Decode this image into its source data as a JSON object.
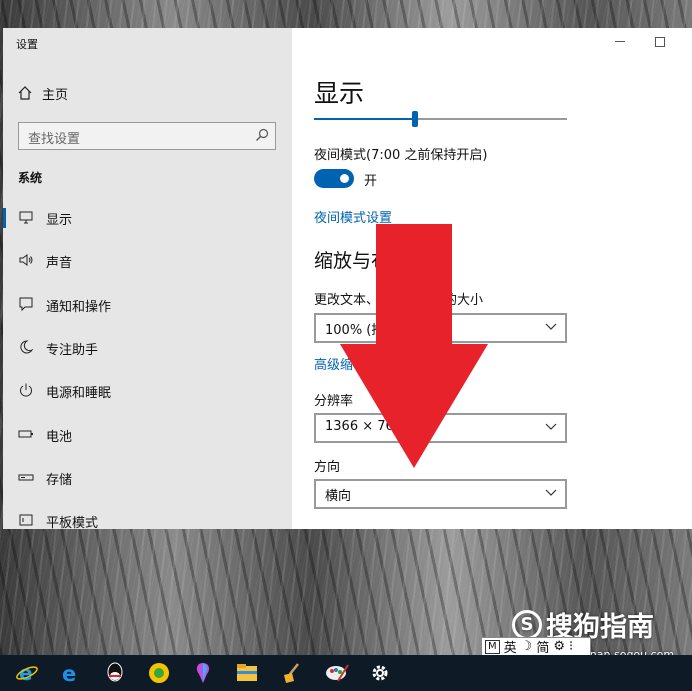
{
  "window": {
    "title": "设置"
  },
  "sidebar": {
    "home_label": "主页",
    "search_placeholder": "查找设置",
    "section": "系统",
    "items": [
      {
        "label": "显示",
        "icon": "monitor-icon",
        "selected": true
      },
      {
        "label": "声音",
        "icon": "speaker-icon"
      },
      {
        "label": "通知和操作",
        "icon": "notification-icon"
      },
      {
        "label": "专注助手",
        "icon": "moon-icon"
      },
      {
        "label": "电源和睡眠",
        "icon": "power-icon"
      },
      {
        "label": "电池",
        "icon": "battery-icon"
      },
      {
        "label": "存储",
        "icon": "storage-icon"
      },
      {
        "label": "平板模式",
        "icon": "tablet-icon"
      }
    ]
  },
  "main": {
    "title": "显示",
    "brightness_level": 0.4,
    "night_light_label": "夜间模式(7:00 之前保持开启)",
    "night_light_state": "开",
    "night_light_settings_link": "夜间模式设置",
    "scale_section_title": "缩放与布",
    "scale_label": "更改文本、应用等项目的大小",
    "scale_value": "100% (推",
    "advanced_scaling_link": "高级缩",
    "resolution_label": "分辨率",
    "resolution_value": "1366 × 768",
    "orientation_label": "方向",
    "orientation_value": "横向"
  },
  "overlay": {
    "arrow_color": "#e8222a",
    "accent": "#0063b1"
  },
  "ime": {
    "mode": "M",
    "lang": "英",
    "moon": "☽",
    "script": "简",
    "gear": "⚙",
    "more": "⁝"
  },
  "watermark": {
    "brand": "搜狗指南",
    "url": "zhinan.sogou.com"
  },
  "taskbar": {
    "apps": [
      "ie-icon",
      "edge-icon",
      "qq-icon",
      "browser360-icon",
      "paint3d-icon",
      "file-explorer-icon",
      "cleanup-icon",
      "paint-icon",
      "settings-gear-icon"
    ]
  }
}
